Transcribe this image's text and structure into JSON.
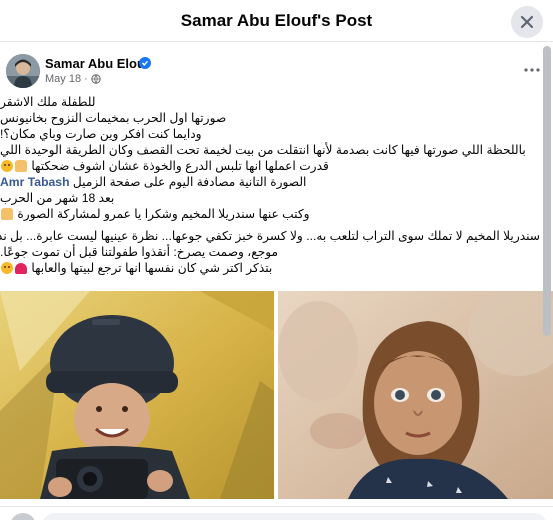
{
  "dialog": {
    "title": "Samar Abu Elouf's Post"
  },
  "post": {
    "author": "Samar Abu Elouf",
    "date": "May 18",
    "separator": "·",
    "lines": [
      "للطفلة ملك الاشقر",
      "صورتها اول الحرب بمخيمات النزوح بخانيونس",
      "ودايما كنت افكر وين صارت وباي مكان؟!",
      "باللحظة اللي صورتها فيها كانت بصدمة لأنها انتقلت من بيت لخيمة تحت القصف وكان الطريقة الوحيدة اللي",
      "قدرت اعملها انها تلبس الدرع والخوذة عشان اشوف ضحكتها",
      "الصورة التانية مصادفة اليوم على صفحة الزميل",
      "بعد 18 شهر من الحرب",
      "وكتب عنها سندريلا المخيم وشكرا يا عمرو لمشاركة الصورة",
      "سندريلا المخيم لا تملك سوى التراب لتلعب به... ولا كسرة خبز تكفي جوعها... نظرة عينيها ليست عابرة... بل نداء",
      "موجع، وصمت يصرخ: أنقذوا طفولتنا قبل أن تموت جوعًا.",
      "بتذكر اكتر شي كان نفسها انها ترجع لبيتها والعابها"
    ],
    "mention": "Amr Tabash"
  },
  "icons": {
    "close": "close-icon",
    "globe": "globe-icon",
    "verified": "verified-badge-icon",
    "more": "more-options-icon"
  },
  "colors": {
    "link": "#385898",
    "verified": "#1877f2",
    "secondary_text": "#65676b"
  }
}
